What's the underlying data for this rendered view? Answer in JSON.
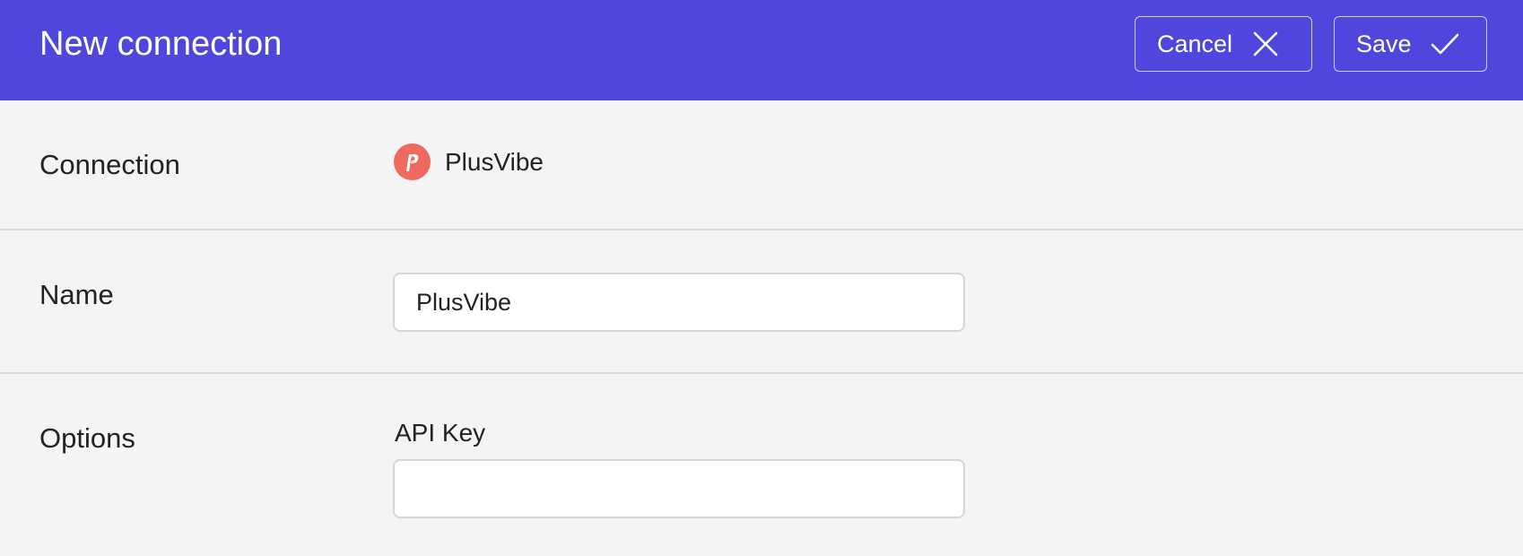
{
  "header": {
    "title": "New connection",
    "cancel_label": "Cancel",
    "save_label": "Save",
    "background_color": "#4f46de",
    "cancel_icon": "close-icon",
    "save_icon": "check-icon"
  },
  "connection_row": {
    "label": "Connection",
    "app_name": "PlusVibe",
    "app_icon": "plusvibe-logo-icon",
    "logo_color": "#ee6a5e"
  },
  "name_row": {
    "label": "Name",
    "value": "PlusVibe"
  },
  "options_row": {
    "label": "Options",
    "api_key_label": "API Key",
    "api_key_value": ""
  }
}
